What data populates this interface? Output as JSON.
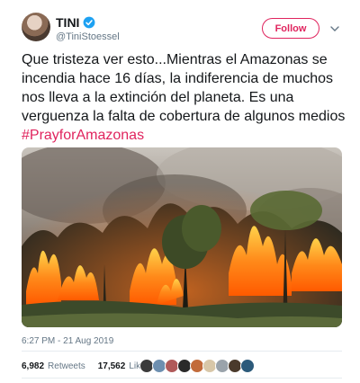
{
  "author": {
    "name": "TINI",
    "handle": "@TiniStoessel",
    "verified": true
  },
  "follow_label": "Follow",
  "tweet": {
    "text": "Que tristeza ver esto...Mientras el Amazonas se incendia hace 16 días, la indiferencia de muchos nos lleva a la extinción del planeta. Es una verguenza la falta de cobertura de algunos medios",
    "hashtag": "#PrayforAmazonas"
  },
  "timestamp": "6:27 PM - 21 Aug 2019",
  "stats": {
    "retweets_count": "6,982",
    "retweets_label": "Retweets",
    "likes_count": "17,562",
    "likes_label": "Likes"
  },
  "colors": {
    "accent": "#e0245e",
    "verified": "#1da1f2",
    "muted": "#657786",
    "text": "#14171a"
  },
  "likers": [
    {
      "color": "#3b3b3b"
    },
    {
      "color": "#6d8fb0"
    },
    {
      "color": "#b05a5a"
    },
    {
      "color": "#2a2a2a"
    },
    {
      "color": "#c26b3b"
    },
    {
      "color": "#d8c7a8"
    },
    {
      "color": "#9aa3ab"
    },
    {
      "color": "#4a3a2c"
    },
    {
      "color": "#2c5a7a"
    }
  ]
}
